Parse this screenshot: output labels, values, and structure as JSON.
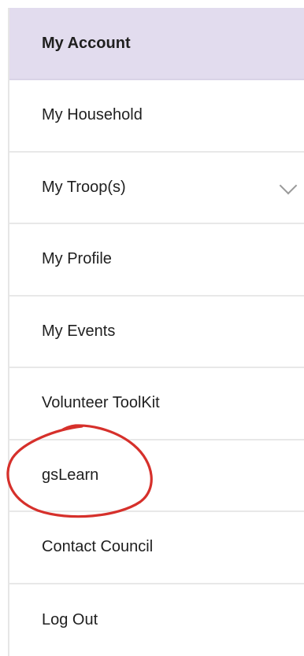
{
  "menu": {
    "items": [
      {
        "label": "My Account"
      },
      {
        "label": "My Household"
      },
      {
        "label": "My Troop(s)"
      },
      {
        "label": "My Profile"
      },
      {
        "label": "My Events"
      },
      {
        "label": "Volunteer ToolKit"
      },
      {
        "label": "gsLearn"
      },
      {
        "label": "Contact Council"
      },
      {
        "label": "Log Out"
      }
    ]
  },
  "icons": {
    "troops_expand": "chevron-down-icon"
  },
  "colors": {
    "header_bg": "#e2dcee",
    "annotation": "#d6302b",
    "divider": "#e8e8e8"
  }
}
